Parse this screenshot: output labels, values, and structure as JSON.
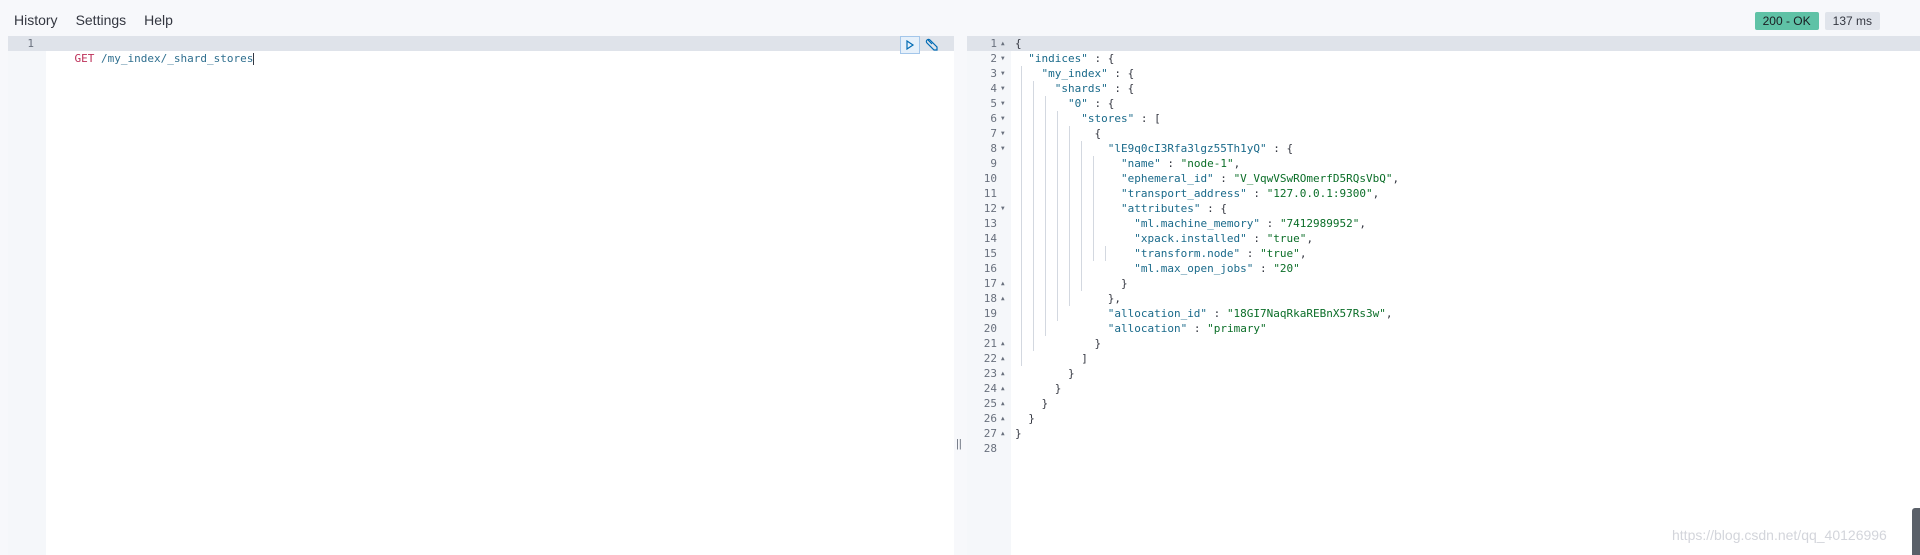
{
  "menu": {
    "items": [
      "History",
      "Settings",
      "Help"
    ]
  },
  "status": {
    "code": "200 - OK",
    "time": "137 ms"
  },
  "request": {
    "line_number": "1",
    "method": "GET",
    "path": "/my_index/_shard_stores"
  },
  "response": {
    "lines": [
      {
        "n": "1",
        "fold": "up",
        "t": [
          [
            "p",
            "{"
          ]
        ]
      },
      {
        "n": "2",
        "fold": "down",
        "t": [
          [
            "p",
            "  "
          ],
          [
            "k",
            "\"indices\""
          ],
          [
            "p",
            " : {"
          ]
        ]
      },
      {
        "n": "3",
        "fold": "down",
        "t": [
          [
            "p",
            "    "
          ],
          [
            "k",
            "\"my_index\""
          ],
          [
            "p",
            " : {"
          ]
        ]
      },
      {
        "n": "4",
        "fold": "down",
        "t": [
          [
            "p",
            "      "
          ],
          [
            "k",
            "\"shards\""
          ],
          [
            "p",
            " : {"
          ]
        ]
      },
      {
        "n": "5",
        "fold": "down",
        "t": [
          [
            "p",
            "        "
          ],
          [
            "k",
            "\"0\""
          ],
          [
            "p",
            " : {"
          ]
        ]
      },
      {
        "n": "6",
        "fold": "down",
        "t": [
          [
            "p",
            "          "
          ],
          [
            "k",
            "\"stores\""
          ],
          [
            "p",
            " : ["
          ]
        ]
      },
      {
        "n": "7",
        "fold": "down",
        "t": [
          [
            "p",
            "            {"
          ]
        ]
      },
      {
        "n": "8",
        "fold": "down",
        "t": [
          [
            "p",
            "              "
          ],
          [
            "k",
            "\"lE9q0cI3Rfa3lgz55Th1yQ\""
          ],
          [
            "p",
            " : {"
          ]
        ]
      },
      {
        "n": "9",
        "fold": "",
        "t": [
          [
            "p",
            "                "
          ],
          [
            "k",
            "\"name\""
          ],
          [
            "p",
            " : "
          ],
          [
            "s",
            "\"node-1\""
          ],
          [
            "p",
            ","
          ]
        ]
      },
      {
        "n": "10",
        "fold": "",
        "t": [
          [
            "p",
            "                "
          ],
          [
            "k",
            "\"ephemeral_id\""
          ],
          [
            "p",
            " : "
          ],
          [
            "s",
            "\"V_VqwVSwROmerfD5RQsVbQ\""
          ],
          [
            "p",
            ","
          ]
        ]
      },
      {
        "n": "11",
        "fold": "",
        "t": [
          [
            "p",
            "                "
          ],
          [
            "k",
            "\"transport_address\""
          ],
          [
            "p",
            " : "
          ],
          [
            "s",
            "\"127.0.0.1:9300\""
          ],
          [
            "p",
            ","
          ]
        ]
      },
      {
        "n": "12",
        "fold": "down",
        "t": [
          [
            "p",
            "                "
          ],
          [
            "k",
            "\"attributes\""
          ],
          [
            "p",
            " : {"
          ]
        ]
      },
      {
        "n": "13",
        "fold": "",
        "t": [
          [
            "p",
            "                  "
          ],
          [
            "k",
            "\"ml.machine_memory\""
          ],
          [
            "p",
            " : "
          ],
          [
            "s",
            "\"7412989952\""
          ],
          [
            "p",
            ","
          ]
        ]
      },
      {
        "n": "14",
        "fold": "",
        "t": [
          [
            "p",
            "                  "
          ],
          [
            "k",
            "\"xpack.installed\""
          ],
          [
            "p",
            " : "
          ],
          [
            "s",
            "\"true\""
          ],
          [
            "p",
            ","
          ]
        ]
      },
      {
        "n": "15",
        "fold": "",
        "t": [
          [
            "p",
            "                  "
          ],
          [
            "k",
            "\"transform.node\""
          ],
          [
            "p",
            " : "
          ],
          [
            "s",
            "\"true\""
          ],
          [
            "p",
            ","
          ]
        ]
      },
      {
        "n": "16",
        "fold": "",
        "t": [
          [
            "p",
            "                  "
          ],
          [
            "k",
            "\"ml.max_open_jobs\""
          ],
          [
            "p",
            " : "
          ],
          [
            "s",
            "\"20\""
          ]
        ]
      },
      {
        "n": "17",
        "fold": "up",
        "t": [
          [
            "p",
            "                }"
          ]
        ]
      },
      {
        "n": "18",
        "fold": "up",
        "t": [
          [
            "p",
            "              },"
          ]
        ]
      },
      {
        "n": "19",
        "fold": "",
        "t": [
          [
            "p",
            "              "
          ],
          [
            "k",
            "\"allocation_id\""
          ],
          [
            "p",
            " : "
          ],
          [
            "s",
            "\"18GI7NaqRkaREBnX57Rs3w\""
          ],
          [
            "p",
            ","
          ]
        ]
      },
      {
        "n": "20",
        "fold": "",
        "t": [
          [
            "p",
            "              "
          ],
          [
            "k",
            "\"allocation\""
          ],
          [
            "p",
            " : "
          ],
          [
            "s",
            "\"primary\""
          ]
        ]
      },
      {
        "n": "21",
        "fold": "up",
        "t": [
          [
            "p",
            "            }"
          ]
        ]
      },
      {
        "n": "22",
        "fold": "up",
        "t": [
          [
            "p",
            "          ]"
          ]
        ]
      },
      {
        "n": "23",
        "fold": "up",
        "t": [
          [
            "p",
            "        }"
          ]
        ]
      },
      {
        "n": "24",
        "fold": "up",
        "t": [
          [
            "p",
            "      }"
          ]
        ]
      },
      {
        "n": "25",
        "fold": "up",
        "t": [
          [
            "p",
            "    }"
          ]
        ]
      },
      {
        "n": "26",
        "fold": "up",
        "t": [
          [
            "p",
            "  }"
          ]
        ]
      },
      {
        "n": "27",
        "fold": "up",
        "t": [
          [
            "p",
            "}"
          ]
        ]
      },
      {
        "n": "28",
        "fold": "",
        "t": []
      }
    ]
  },
  "icons": {
    "run": "play-icon",
    "settings": "wrench-icon"
  },
  "watermark": "https://blog.csdn.net/qq_40126996"
}
